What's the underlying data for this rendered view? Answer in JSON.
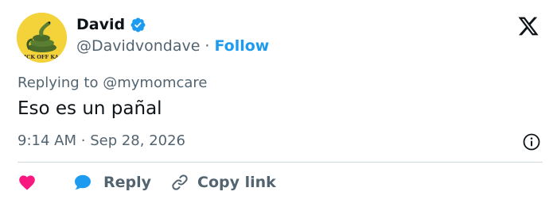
{
  "author": {
    "name": "David",
    "handle": "@Davidvondave",
    "verified": true,
    "avatar_icon": "gadsden-flag-snake-avatar",
    "avatar_text": "ICK OFF KA"
  },
  "header": {
    "separator": "·",
    "follow_label": "Follow",
    "logo_icon": "x-logo-icon"
  },
  "reply_context": {
    "prefix": "Replying to",
    "mention": "@mymomcare"
  },
  "tweet": {
    "text": "Eso es un pañal",
    "time": "9:14 AM",
    "separator": "·",
    "date": "Sep 28, 2026"
  },
  "actions": {
    "like_icon": "heart-icon",
    "like_color": "#f91880",
    "reply_label": "Reply",
    "reply_icon": "speech-bubble-icon",
    "reply_color": "#1d9bf0",
    "copy_label": "Copy link",
    "copy_icon": "link-icon"
  },
  "colors": {
    "text_primary": "#0f1419",
    "text_secondary": "#536471",
    "accent": "#1d9bf0",
    "divider": "#cfd9de",
    "avatar_bg": "#f3d23a"
  }
}
